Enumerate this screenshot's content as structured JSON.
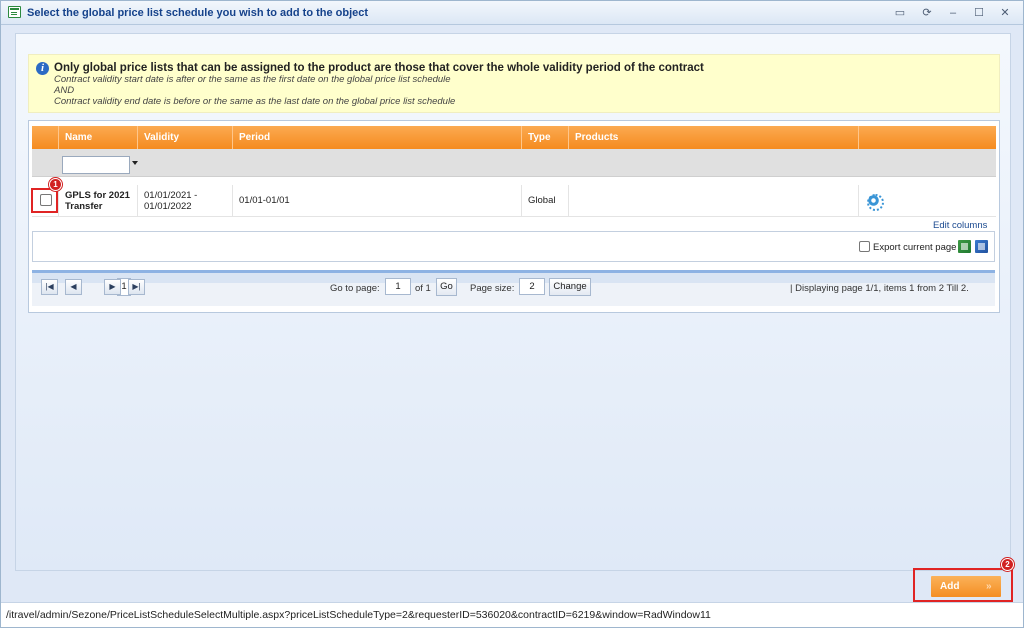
{
  "window": {
    "title": "Select the global price list schedule you wish to add to the object",
    "controls": [
      "pin-icon",
      "reload-icon",
      "minimize-icon",
      "maximize-icon",
      "close-icon"
    ]
  },
  "notice": {
    "title": "Only global price lists that can be assigned to the product are those that cover the whole validity period of the contract",
    "line1": "Contract validity start date is after or the same as the first date on the global price list schedule",
    "line2": "AND",
    "line3": "Contract validity end date is before or the same as the last date on the global price list schedule"
  },
  "grid": {
    "columns": {
      "name": "Name",
      "validity": "Validity",
      "period": "Period",
      "type": "Type",
      "products": "Products"
    },
    "rows": [
      {
        "name_line1": "GPLS for 2021",
        "name_line2": "Transfer",
        "validity_line1": "01/01/2021 -",
        "validity_line2": "01/01/2022",
        "period": "01/01-01/01",
        "type": "Global",
        "products": ""
      }
    ],
    "edit_columns": "Edit columns",
    "export_label": "Export current page"
  },
  "pager": {
    "current_page": "1",
    "go_to_page_label": "Go to page:",
    "page_input": "1",
    "of_label": "of 1",
    "go_label": "Go",
    "page_size_label": "Page size:",
    "page_size": "2",
    "change_label": "Change",
    "info": "| Displaying page  1/1,  items  1  from  2  Till  2."
  },
  "markers": {
    "one": "1",
    "two": "2"
  },
  "actions": {
    "add_label": "Add",
    "add_chevron": "»"
  },
  "status": {
    "url": "/itravel/admin/Sezone/PriceListScheduleSelectMultiple.aspx?priceListScheduleType=2&requesterID=536020&contractID=6219&window=RadWindow11"
  },
  "colors": {
    "accent_orange": "#f58b1f",
    "marker_red": "#e02424",
    "title_blue": "#15428b"
  }
}
